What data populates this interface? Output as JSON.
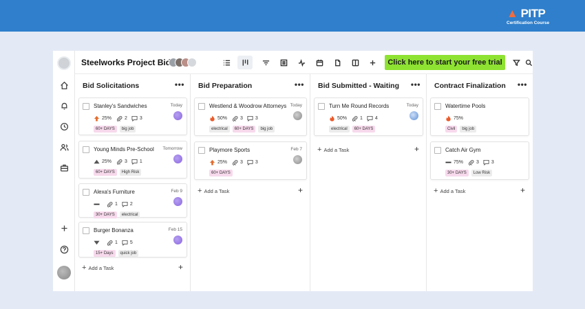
{
  "brand": {
    "mark": "PITP",
    "subtitle": "Certification Course"
  },
  "project": {
    "title": "Steelworks Project Bids"
  },
  "cta": {
    "label": "Click here to start your free trial"
  },
  "toolbar": {
    "icons": [
      "list-icon",
      "board-icon",
      "filter-lines-icon",
      "table-icon",
      "activity-icon",
      "calendar-icon",
      "document-icon",
      "split-icon",
      "plus-icon",
      "funnel-icon",
      "search-icon"
    ]
  },
  "add_task_label": "Add a Task",
  "columns": [
    {
      "name": "Bid Solicitations",
      "cards": [
        {
          "title": "Stanley's Sandwiches",
          "date": "Today",
          "priority": "up",
          "percent": "25%",
          "attachments": "2",
          "comments": "3",
          "tags": [
            {
              "text": "60+ DAYS",
              "color": "pink"
            },
            {
              "text": "big job",
              "color": "gray"
            }
          ]
        },
        {
          "title": "Young Minds Pre-School",
          "date": "Tomorrow",
          "priority": "tri-up",
          "percent": "25%",
          "attachments": "3",
          "comments": "1",
          "tags": [
            {
              "text": "60+ DAYS",
              "color": "pink"
            },
            {
              "text": "High Risk",
              "color": "gray"
            }
          ]
        },
        {
          "title": "Alexa's Furniture",
          "date": "Feb 9",
          "priority": "flat",
          "percent": "",
          "attachments": "1",
          "comments": "2",
          "tags": [
            {
              "text": "30+ DAYS",
              "color": "pink"
            },
            {
              "text": "electrical",
              "color": "gray"
            }
          ]
        },
        {
          "title": "Burger Bonanza",
          "date": "Feb 15",
          "priority": "down",
          "percent": "",
          "attachments": "1",
          "comments": "5",
          "tags": [
            {
              "text": "15+ Days",
              "color": "pink"
            },
            {
              "text": "quick job",
              "color": "gray"
            }
          ]
        }
      ]
    },
    {
      "name": "Bid Preparation",
      "cards": [
        {
          "title": "Westlend & Woodrow Attorneys",
          "date": "Today",
          "priority": "fire",
          "percent": "50%",
          "attachments": "3",
          "comments": "3",
          "tags": [
            {
              "text": "electrical",
              "color": "gray"
            },
            {
              "text": "60+ DAYS",
              "color": "pink"
            },
            {
              "text": "big job",
              "color": "gray"
            }
          ]
        },
        {
          "title": "Playmore Sports",
          "date": "Feb 7",
          "priority": "up",
          "percent": "25%",
          "attachments": "3",
          "comments": "3",
          "tags": [
            {
              "text": "60+ DAYS",
              "color": "pink"
            }
          ]
        }
      ]
    },
    {
      "name": "Bid Submitted - Waiting",
      "cards": [
        {
          "title": "Turn Me Round Records",
          "date": "Today",
          "priority": "fire",
          "percent": "50%",
          "attachments": "1",
          "comments": "4",
          "tags": [
            {
              "text": "electrical",
              "color": "gray"
            },
            {
              "text": "60+ DAYS",
              "color": "pink"
            }
          ]
        }
      ]
    },
    {
      "name": "Contract Finalization",
      "cards": [
        {
          "title": "Watertime Pools",
          "date": "",
          "priority": "fire",
          "percent": "75%",
          "attachments": "",
          "comments": "",
          "tags": [
            {
              "text": "Civil",
              "color": "pink"
            },
            {
              "text": "big job",
              "color": "gray"
            }
          ]
        },
        {
          "title": "Catch Air Gym",
          "date": "",
          "priority": "flat",
          "percent": "75%",
          "attachments": "3",
          "comments": "3",
          "tags": [
            {
              "text": "30+ DAYS",
              "color": "pink"
            },
            {
              "text": "Low Risk",
              "color": "gray"
            }
          ]
        }
      ]
    }
  ]
}
